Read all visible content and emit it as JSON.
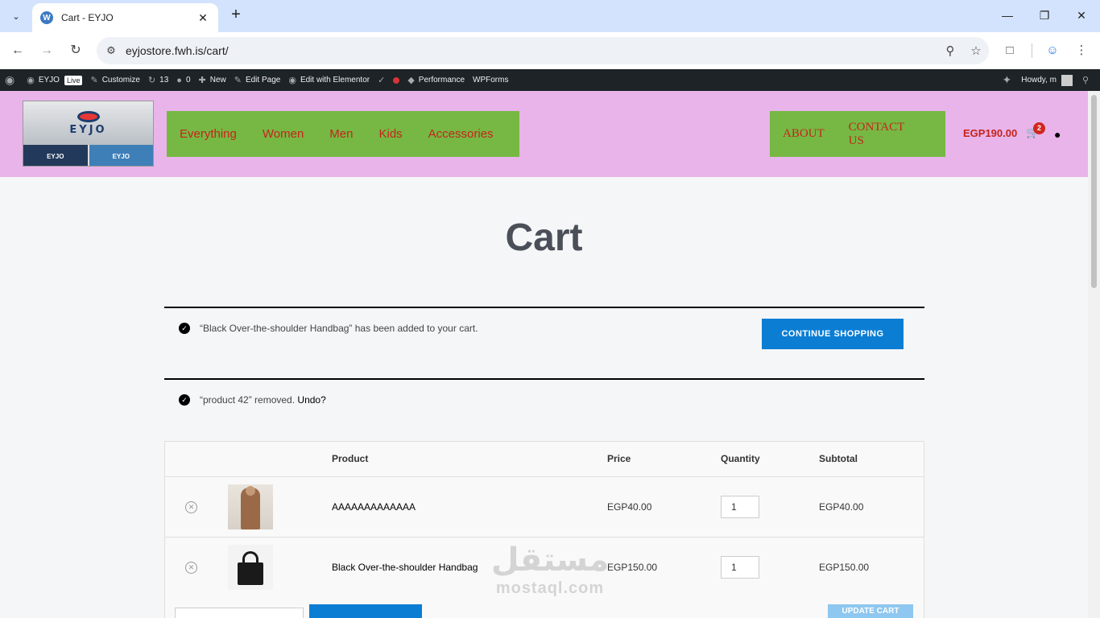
{
  "browser": {
    "tab_title": "Cart - EYJO",
    "tab_favicon": "W",
    "new_tab_label": "+",
    "url": "eyjostore.fwh.is/cart/"
  },
  "adminbar": {
    "site_name": "EYJO",
    "live_badge": "Live",
    "customize": "Customize",
    "updates_count": "13",
    "comments_count": "0",
    "new_label": "New",
    "edit_page": "Edit Page",
    "edit_elementor": "Edit with Elementor",
    "performance": "Performance",
    "wpforms": "WPForms",
    "howdy": "Howdy, m"
  },
  "header": {
    "logo_text": "EYJO",
    "logo_sub_a": "EYJO",
    "logo_sub_b": "EYJO",
    "menu_left": [
      "Everything",
      "Women",
      "Men",
      "Kids",
      "Accessories"
    ],
    "menu_right": [
      "ABOUT",
      "CONTACT US"
    ],
    "cart_total": "EGP190.00",
    "cart_count": "2",
    "colors": {
      "header_bg": "#e8b4ea",
      "menu_bg": "#76b843",
      "menu_text": "#c6241c"
    }
  },
  "page": {
    "title": "Cart"
  },
  "notices": {
    "added_text": "“Black Over-the-shoulder Handbag” has been added to your cart.",
    "continue_label": "CONTINUE SHOPPING",
    "removed_text": "“product 42” removed.",
    "undo_label": "Undo?"
  },
  "cart": {
    "headers": {
      "product": "Product",
      "price": "Price",
      "quantity": "Quantity",
      "subtotal": "Subtotal"
    },
    "items": [
      {
        "name": "AAAAAAAAAAAAA",
        "price": "EGP40.00",
        "qty": "1",
        "subtotal": "EGP40.00"
      },
      {
        "name": "Black Over-the-shoulder Handbag",
        "price": "EGP150.00",
        "qty": "1",
        "subtotal": "EGP150.00"
      }
    ],
    "update_label": "UPDATE CART"
  },
  "watermark": {
    "arabic": "مستقل",
    "latin": "mostaql.com"
  }
}
